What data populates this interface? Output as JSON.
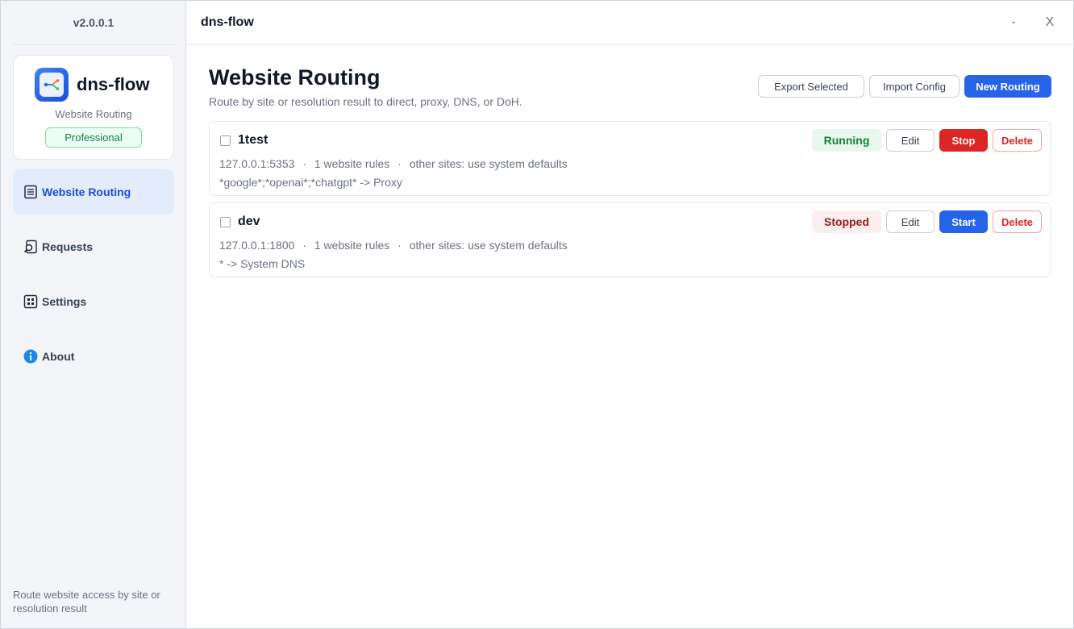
{
  "sidebar": {
    "version": "v2.0.0.1",
    "brand": {
      "name": "dns-flow",
      "subtitle": "Website Routing",
      "plan": "Professional"
    },
    "nav": [
      {
        "label": "Website Routing",
        "icon": "list-icon",
        "active": true
      },
      {
        "label": "Requests",
        "icon": "magnifier-doc-icon",
        "active": false
      },
      {
        "label": "Settings",
        "icon": "grid-icon",
        "active": false
      },
      {
        "label": "About",
        "icon": "info-icon",
        "active": false
      }
    ],
    "footer": "Route website access by site or resolution result"
  },
  "titlebar": {
    "title": "dns-flow",
    "minimize": "-",
    "close": "X"
  },
  "main": {
    "title": "Website Routing",
    "subtitle": "Route by site or resolution result to direct, proxy, DNS, or DoH.",
    "actions": {
      "export": "Export Selected",
      "import": "Import Config",
      "new": "New Routing"
    },
    "routings": [
      {
        "name": "1test",
        "address": "127.0.0.1:5353",
        "rules": "1 website rules",
        "other": "other sites: use system defaults",
        "rule_line": "*google*;*openai*;*chatgpt* -> Proxy",
        "status": "Running",
        "edit": "Edit",
        "toggle": "Stop",
        "delete": "Delete"
      },
      {
        "name": "dev",
        "address": "127.0.0.1:1800",
        "rules": "1 website rules",
        "other": "other sites: use system defaults",
        "rule_line": "* -> System DNS",
        "status": "Stopped",
        "edit": "Edit",
        "toggle": "Start",
        "delete": "Delete"
      }
    ],
    "separator": "·"
  },
  "colors": {
    "accent": "#2563eb",
    "danger": "#dc2626",
    "running": "#15803d",
    "stopped": "#991b1b"
  }
}
